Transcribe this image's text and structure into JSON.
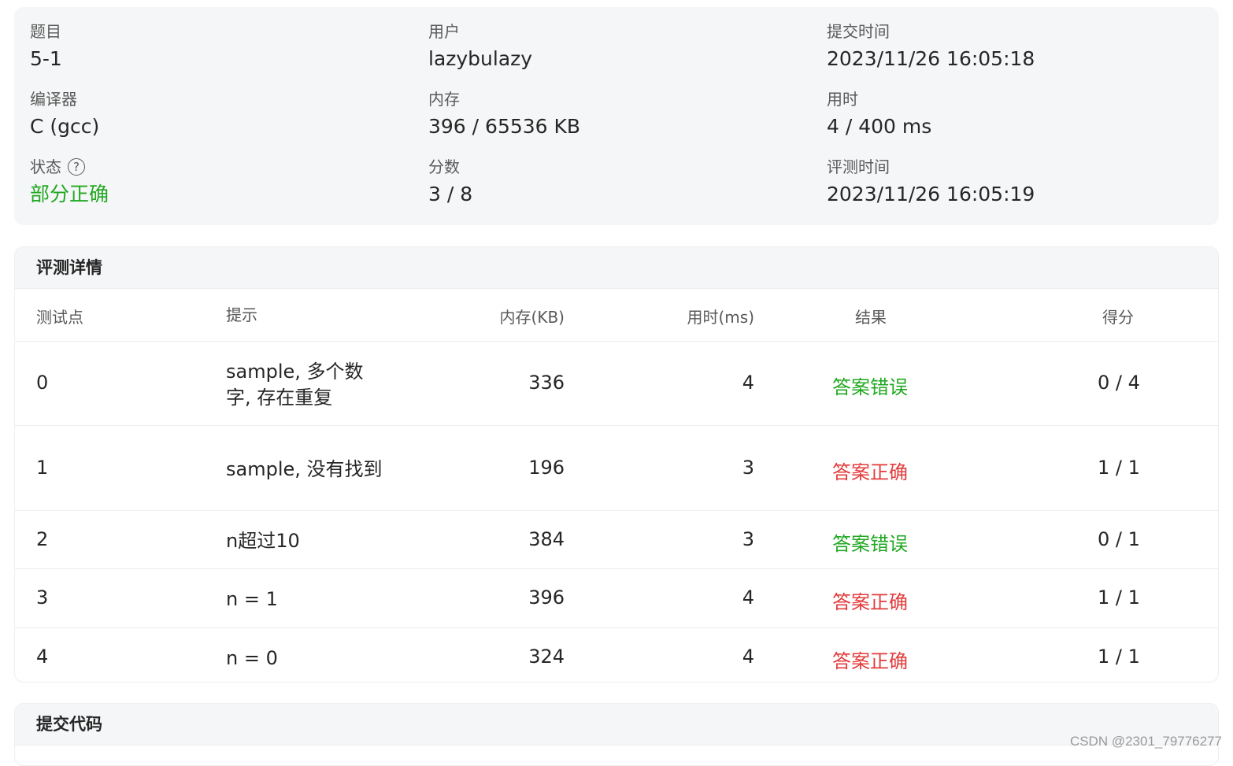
{
  "summary": {
    "problem_label": "题目",
    "problem_value": "5-1",
    "user_label": "用户",
    "user_value": "lazybulazy",
    "submit_time_label": "提交时间",
    "submit_time_value": "2023/11/26 16:05:18",
    "compiler_label": "编译器",
    "compiler_value": "C (gcc)",
    "memory_label": "内存",
    "memory_value": "396 / 65536 KB",
    "time_label": "用时",
    "time_value": "4 / 400 ms",
    "status_label": "状态",
    "status_help_icon": "?",
    "status_value": "部分正确",
    "score_label": "分数",
    "score_value": "3 / 8",
    "judge_time_label": "评测时间",
    "judge_time_value": "2023/11/26 16:05:19"
  },
  "details": {
    "title": "评测详情",
    "columns": [
      "测试点",
      "提示",
      "内存(KB)",
      "用时(ms)",
      "结果",
      "得分"
    ],
    "rows": [
      {
        "id": "0",
        "hint": "sample, 多个数字, 存在重复",
        "memory": "336",
        "time": "4",
        "result": "答案错误",
        "result_color": "#22a822",
        "score": "0 / 4"
      },
      {
        "id": "1",
        "hint": "sample, 没有找到",
        "memory": "196",
        "time": "3",
        "result": "答案正确",
        "result_color": "#e33b3b",
        "score": "1 / 1"
      },
      {
        "id": "2",
        "hint": "n超过10",
        "memory": "384",
        "time": "3",
        "result": "答案错误",
        "result_color": "#22a822",
        "score": "0 / 1"
      },
      {
        "id": "3",
        "hint": "n = 1",
        "memory": "396",
        "time": "4",
        "result": "答案正确",
        "result_color": "#e33b3b",
        "score": "1 / 1"
      },
      {
        "id": "4",
        "hint": "n = 0",
        "memory": "324",
        "time": "4",
        "result": "答案正确",
        "result_color": "#e33b3b",
        "score": "1 / 1"
      }
    ]
  },
  "code": {
    "title": "提交代码"
  },
  "watermark": "CSDN @2301_79776277"
}
